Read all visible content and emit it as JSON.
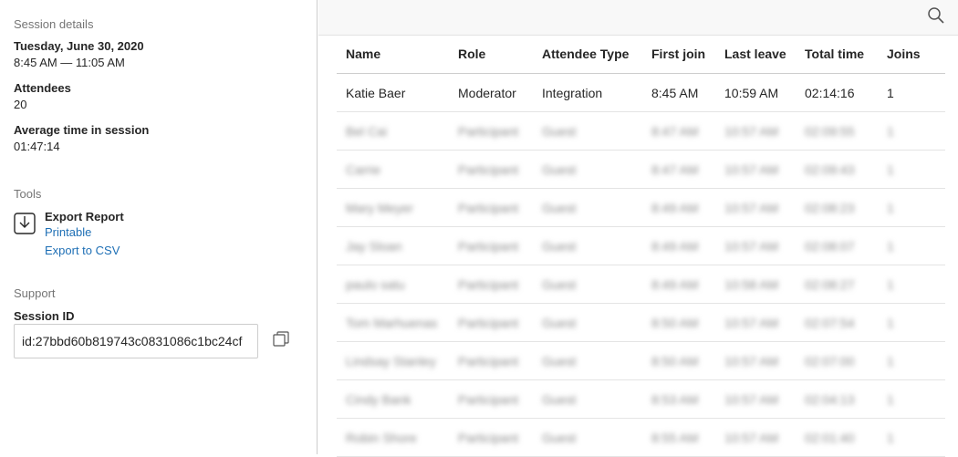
{
  "sidebar": {
    "session_details_title": "Session details",
    "date": "Tuesday, June 30, 2020",
    "time_range": "8:45 AM — 11:05 AM",
    "attendees_label": "Attendees",
    "attendees_value": "20",
    "avg_time_label": "Average time in session",
    "avg_time_value": "01:47:14",
    "tools_title": "Tools",
    "export_report_label": "Export Report",
    "printable_link": "Printable",
    "export_csv_link": "Export to CSV",
    "support_title": "Support",
    "session_id_label": "Session ID",
    "session_id_value": "id:27bbd60b819743c0831086c1bc24cf",
    "icons": {
      "export": "download-icon",
      "copy": "copy-icon"
    }
  },
  "toolbar": {
    "search_icon": "search-icon"
  },
  "table": {
    "headers": [
      "Name",
      "Role",
      "Attendee Type",
      "First join",
      "Last leave",
      "Total time",
      "Joins"
    ],
    "rows": [
      [
        "Katie Baer",
        "Moderator",
        "Integration",
        "8:45 AM",
        "10:59 AM",
        "02:14:16",
        "1"
      ],
      [
        "Bel Cai",
        "Participant",
        "Guest",
        "8:47 AM",
        "10:57 AM",
        "02:09:55",
        "1"
      ],
      [
        "Carrie",
        "Participant",
        "Guest",
        "8:47 AM",
        "10:57 AM",
        "02:09:43",
        "1"
      ],
      [
        "Mary Meyer",
        "Participant",
        "Guest",
        "8:49 AM",
        "10:57 AM",
        "02:08:23",
        "1"
      ],
      [
        "Jay Sloan",
        "Participant",
        "Guest",
        "8:49 AM",
        "10:57 AM",
        "02:08:07",
        "1"
      ],
      [
        "paulo satu",
        "Participant",
        "Guest",
        "8:49 AM",
        "10:58 AM",
        "02:08:27",
        "1"
      ],
      [
        "Tom Marhuenas",
        "Participant",
        "Guest",
        "8:50 AM",
        "10:57 AM",
        "02:07:54",
        "1"
      ],
      [
        "Lindsay Stanley",
        "Participant",
        "Guest",
        "8:50 AM",
        "10:57 AM",
        "02:07:00",
        "1"
      ],
      [
        "Cindy Bank",
        "Participant",
        "Guest",
        "8:53 AM",
        "10:57 AM",
        "02:04:13",
        "1"
      ],
      [
        "Robin Shore",
        "Participant",
        "Guest",
        "8:55 AM",
        "10:57 AM",
        "02:01:40",
        "1"
      ]
    ]
  }
}
